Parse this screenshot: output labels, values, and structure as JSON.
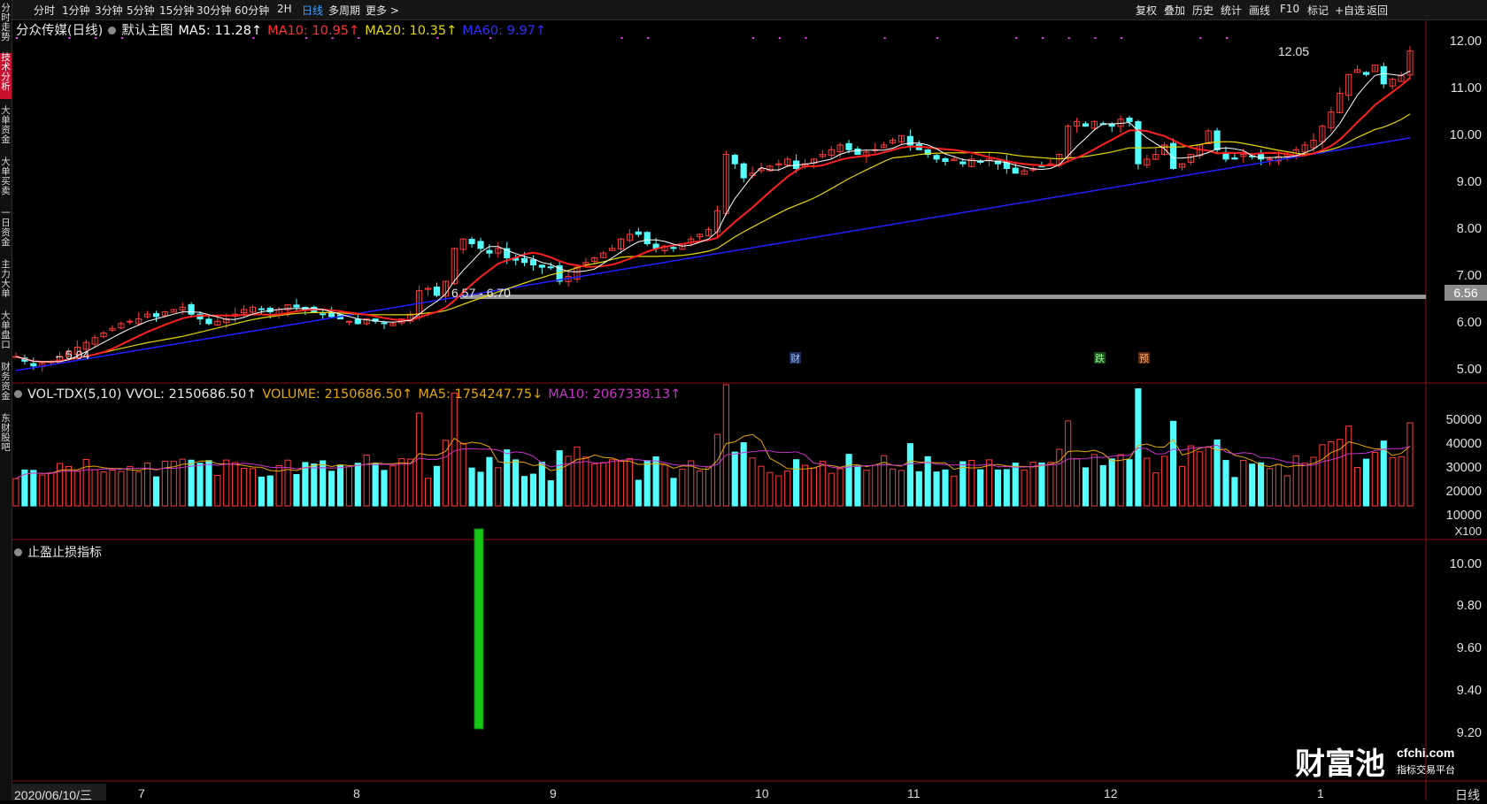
{
  "topbar": {
    "timeframes": [
      "分时",
      "1分钟",
      "3分钟",
      "5分钟",
      "15分钟",
      "30分钟",
      "60分钟",
      "2H",
      "日线",
      "多周期",
      "更多 >"
    ],
    "active_timeframe": "日线",
    "right_buttons": [
      "复权",
      "叠加",
      "历史",
      "统计",
      "画线",
      "F10",
      "标记",
      "+自选",
      "返回"
    ]
  },
  "sidebar": {
    "items": [
      "分时走势",
      "技术分析",
      "大单资金",
      "大单买卖",
      "一日资金",
      "主力大单",
      "大单盘口",
      "财务资金",
      "东财股吧"
    ],
    "active_item": "技术分析"
  },
  "main_panel": {
    "stock_name": "分众传媒(日线)",
    "template": "默认主图",
    "ma5": "MA5: 11.28↑",
    "ma10": "MA10: 10.95↑",
    "ma20": "MA20: 10.35↑",
    "ma60": "MA60: 9.97↑",
    "high_label": "12.05",
    "low_label": "5.04",
    "range_label": "6.57 - 6.70",
    "price_line_value": "6.56",
    "event_markers": {
      "finance": "财",
      "fall": "跌",
      "forecast": "预"
    },
    "y_ticks": [
      "12.00",
      "11.00",
      "10.00",
      "9.00",
      "8.00",
      "7.00",
      "6.00",
      "5.00"
    ],
    "ma_colors": {
      "ma5": "#ffffff",
      "ma10": "#ff2020",
      "ma20": "#e6d800",
      "ma60": "#2020ff"
    }
  },
  "volume_panel": {
    "indicator": "VOL-TDX(5,10) VVOL: 2150686.50↑",
    "volume": "VOLUME: 2150686.50↑",
    "ma5": "MA5: 1754247.75↓",
    "ma10": "MA10: 2067338.13↑",
    "y_ticks": [
      "50000",
      "40000",
      "30000",
      "20000",
      "10000"
    ],
    "unit": "X100",
    "colors": {
      "volume": "#e6a800",
      "ma5": "#e6a800",
      "ma10": "#cc33cc"
    }
  },
  "indicator_panel": {
    "name": "止盈止损指标",
    "y_ticks": [
      "10.00",
      "9.80",
      "9.60",
      "9.40",
      "9.20"
    ]
  },
  "date_axis": {
    "start_date": "2020/06/10/三",
    "months": [
      "7",
      "8",
      "9",
      "10",
      "11",
      "12",
      "1"
    ],
    "period": "日线"
  },
  "watermark": {
    "brand": "财富池",
    "site": "cfchi.com",
    "tagline": "指标交易平台"
  },
  "chart_data": {
    "type": "candlestick",
    "x_start": "2020/06/10",
    "ylim": [
      4.8,
      12.3
    ],
    "closes": [
      5.3,
      5.2,
      5.1,
      5.15,
      5.2,
      5.3,
      5.4,
      5.5,
      5.6,
      5.7,
      5.8,
      5.9,
      6.0,
      6.05,
      6.1,
      6.2,
      6.15,
      6.25,
      6.3,
      6.35,
      6.2,
      6.1,
      6.0,
      6.05,
      6.1,
      6.2,
      6.3,
      6.35,
      6.3,
      6.25,
      6.3,
      6.4,
      6.35,
      6.3,
      6.25,
      6.2,
      6.15,
      6.1,
      6.05,
      6.0,
      6.1,
      6.05,
      6.0,
      6.0,
      6.1,
      6.2,
      6.7,
      6.75,
      6.6,
      6.9,
      7.6,
      7.8,
      7.7,
      7.6,
      7.5,
      7.6,
      7.4,
      7.35,
      7.3,
      7.25,
      7.2,
      7.2,
      6.9,
      7.0,
      7.2,
      7.3,
      7.4,
      7.5,
      7.6,
      7.8,
      7.9,
      7.9,
      7.7,
      7.6,
      7.65,
      7.6,
      7.7,
      7.8,
      7.9,
      8.0,
      8.4,
      9.6,
      9.4,
      9.1,
      9.2,
      9.3,
      9.35,
      9.4,
      9.5,
      9.3,
      9.4,
      9.5,
      9.6,
      9.7,
      9.8,
      9.7,
      9.6,
      9.65,
      9.7,
      9.8,
      9.9,
      10.0,
      9.8,
      9.7,
      9.6,
      9.5,
      9.45,
      9.5,
      9.4,
      9.5,
      9.45,
      9.5,
      9.4,
      9.3,
      9.2,
      9.25,
      9.3,
      9.35,
      9.4,
      9.6,
      10.2,
      10.3,
      10.2,
      10.3,
      10.25,
      10.2,
      10.35,
      10.3,
      9.4,
      9.5,
      9.6,
      9.8,
      9.3,
      9.4,
      9.6,
      9.8,
      10.1,
      9.7,
      9.5,
      9.5,
      9.6,
      9.55,
      9.5,
      9.5,
      9.55,
      9.6,
      9.7,
      9.8,
      9.9,
      10.2,
      10.5,
      10.9,
      11.3,
      11.4,
      11.3,
      11.5,
      11.1,
      11.2,
      11.28,
      11.8
    ]
  }
}
